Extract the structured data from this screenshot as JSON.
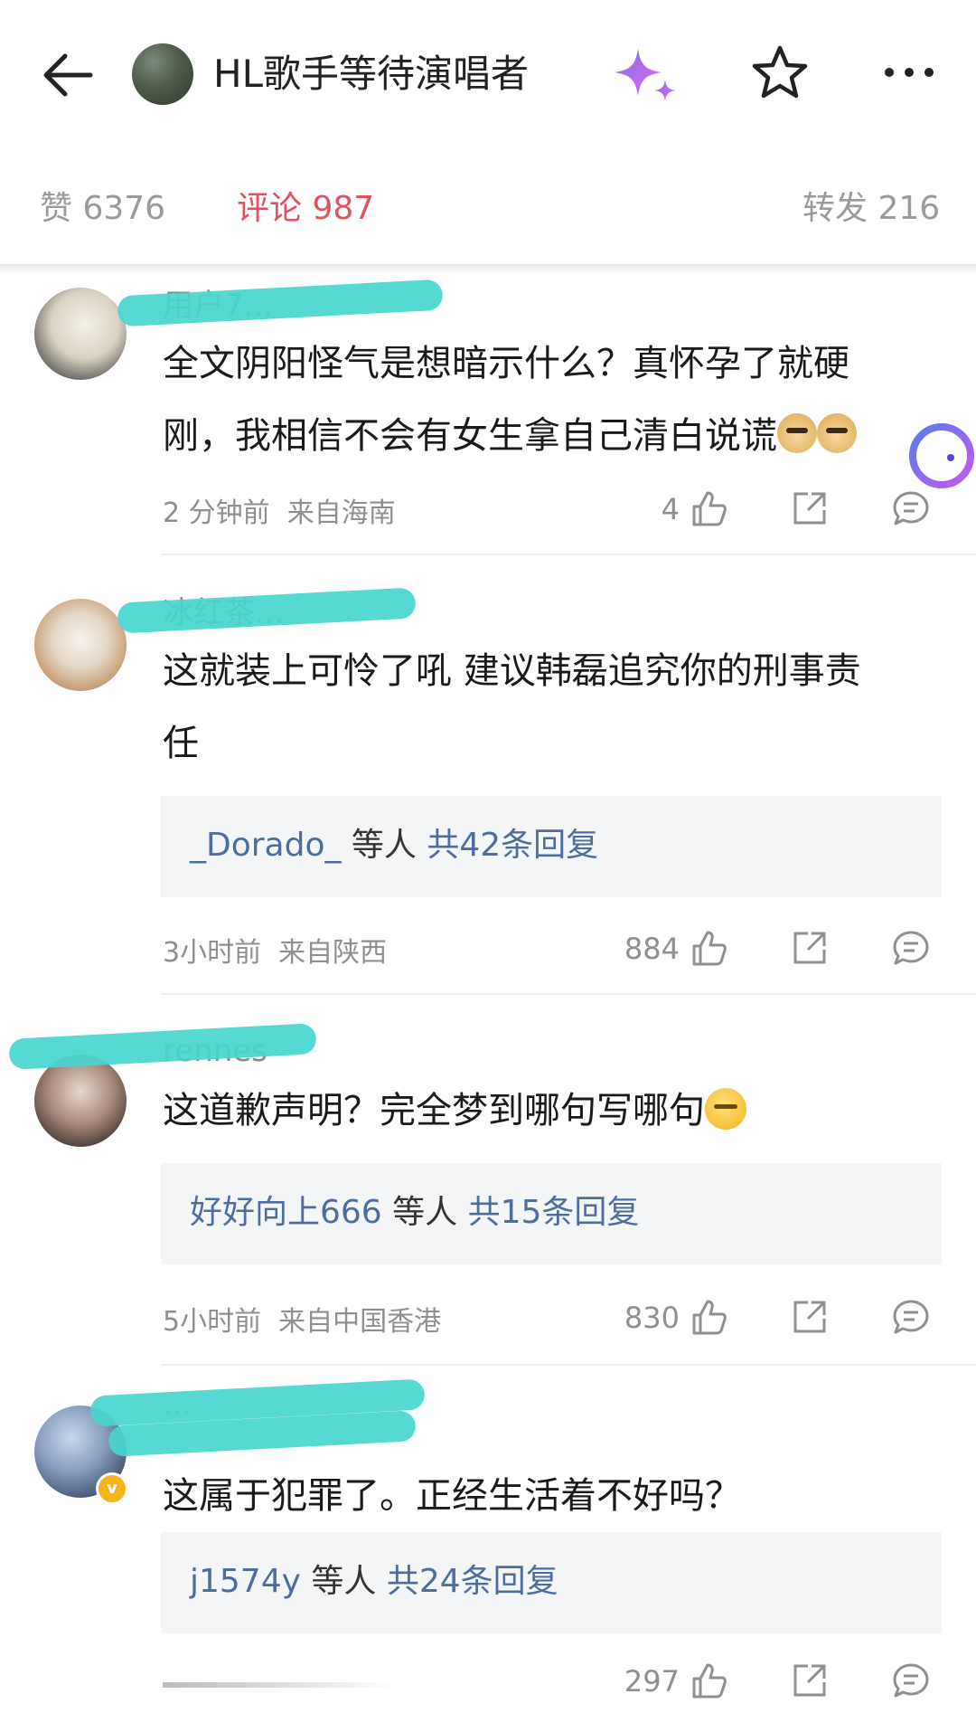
{
  "header": {
    "title": "HL歌手等待演唱者",
    "icons": [
      "back-arrow-icon",
      "sparkle-icon",
      "star-icon",
      "more-icon"
    ]
  },
  "tabs": {
    "likes": "赞 6376",
    "comments": "评论 987",
    "reposts": "转发 216"
  },
  "colors": {
    "accent": "#e0505f",
    "link": "#4d6e9c",
    "scribble": "#49d6cf"
  },
  "comments": [
    {
      "username": "用户7...",
      "text_line1": "全文阴阳怪气是想暗示什么？真怀孕了就硬",
      "text_line2": "刚，我相信不会有女生拿自己清白说谎",
      "time": "2 分钟前",
      "location": "来自海南",
      "likes": "4"
    },
    {
      "username": "冰红茶...",
      "text_line1": "这就装上可怜了吼 建议韩磊追究你的刑事责",
      "text_line2": "任",
      "reply_user": "_Dorado_",
      "reply_mid": " 等人 ",
      "reply_count": "共42条回复",
      "time": "3小时前",
      "location": "来自陕西",
      "likes": "884"
    },
    {
      "username": "rennes",
      "text_line1": "这道歉声明？完全梦到哪句写哪句",
      "reply_user": "好好向上666",
      "reply_mid": " 等人 ",
      "reply_count": "共15条回复",
      "time": "5小时前",
      "location": "来自中国香港",
      "likes": "830"
    },
    {
      "username": "...",
      "text_line1": "这属于犯罪了。正经生活着不好吗？",
      "reply_user": "j1574y",
      "reply_mid": " 等人 ",
      "reply_count": "共24条回复",
      "likes": "297"
    }
  ]
}
